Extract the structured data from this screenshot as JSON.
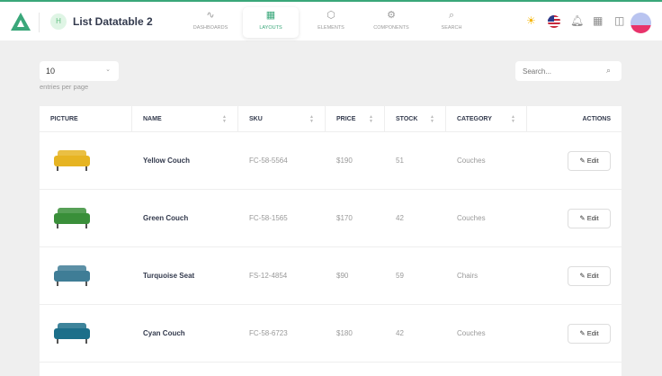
{
  "header": {
    "title": "List Datatable 2",
    "avatar_initial": "H",
    "nav": [
      {
        "label": "DASHBOARDS",
        "icon": "∿"
      },
      {
        "label": "LAYOUTS",
        "icon": "▦"
      },
      {
        "label": "ELEMENTS",
        "icon": "⬡"
      },
      {
        "label": "COMPONENTS",
        "icon": "⚙"
      },
      {
        "label": "SEARCH",
        "icon": "⌕"
      }
    ]
  },
  "controls": {
    "entries_value": "10",
    "entries_label": "entries per page",
    "search_placeholder": "Search..."
  },
  "table": {
    "headers": [
      "PICTURE",
      "NAME",
      "SKU",
      "PRICE",
      "STOCK",
      "CATEGORY",
      "ACTIONS"
    ],
    "rows": [
      {
        "name": "Yellow Couch",
        "sku": "FC-58-5564",
        "price": "$190",
        "stock": "51",
        "category": "Couches",
        "color": "#e6b422"
      },
      {
        "name": "Green Couch",
        "sku": "FC-58-1565",
        "price": "$170",
        "stock": "42",
        "category": "Couches",
        "color": "#3a8f3a"
      },
      {
        "name": "Turquoise Seat",
        "sku": "FS-12-4854",
        "price": "$90",
        "stock": "59",
        "category": "Chairs",
        "color": "#3f7d96"
      },
      {
        "name": "Cyan Couch",
        "sku": "FC-58-6723",
        "price": "$180",
        "stock": "42",
        "category": "Couches",
        "color": "#1c6f8a"
      }
    ],
    "edit_label": "Edit"
  },
  "colors": {
    "accent": "#3aa77a"
  }
}
